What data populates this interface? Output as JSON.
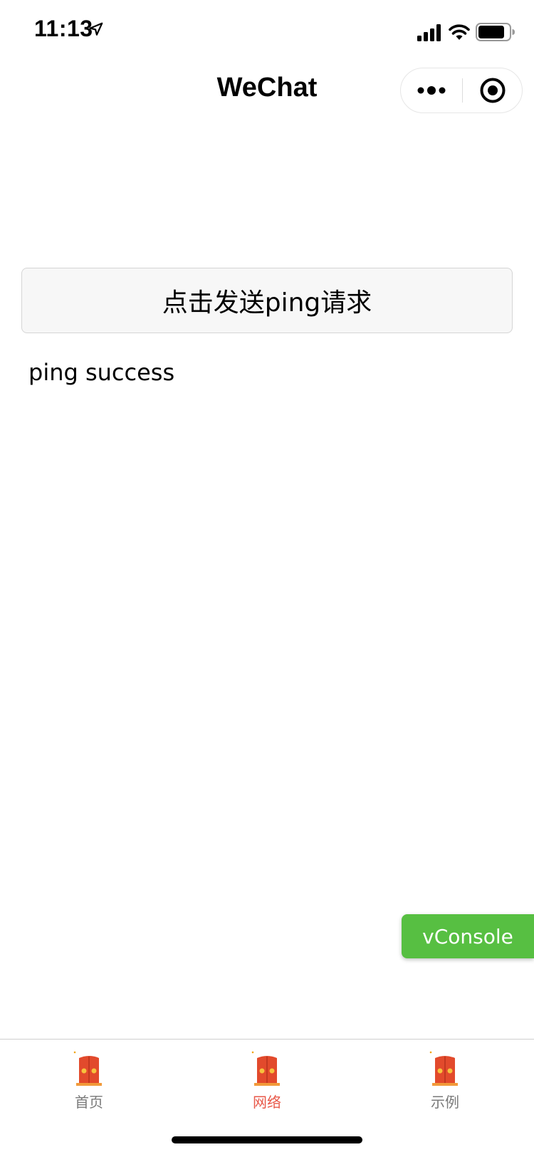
{
  "status_bar": {
    "time": "11:13",
    "location_icon": "location-arrow-icon",
    "signal_icon": "cellular-signal-icon",
    "wifi_icon": "wifi-icon",
    "battery_icon": "battery-icon"
  },
  "nav": {
    "title": "WeChat",
    "capsule": {
      "more_icon": "more-dots-icon",
      "close_icon": "target-icon"
    }
  },
  "main": {
    "ping_button_label": "点击发送ping请求",
    "result_text": "ping success"
  },
  "vconsole": {
    "label": "vConsole",
    "color": "#57bf42"
  },
  "tab_bar": {
    "items": [
      {
        "label": "首页",
        "icon": "red-door-icon",
        "active": false
      },
      {
        "label": "网络",
        "icon": "red-door-icon",
        "active": true
      },
      {
        "label": "示例",
        "icon": "red-door-icon",
        "active": false
      }
    ],
    "active_color": "#e8594a",
    "inactive_color": "#7a7a7a"
  }
}
